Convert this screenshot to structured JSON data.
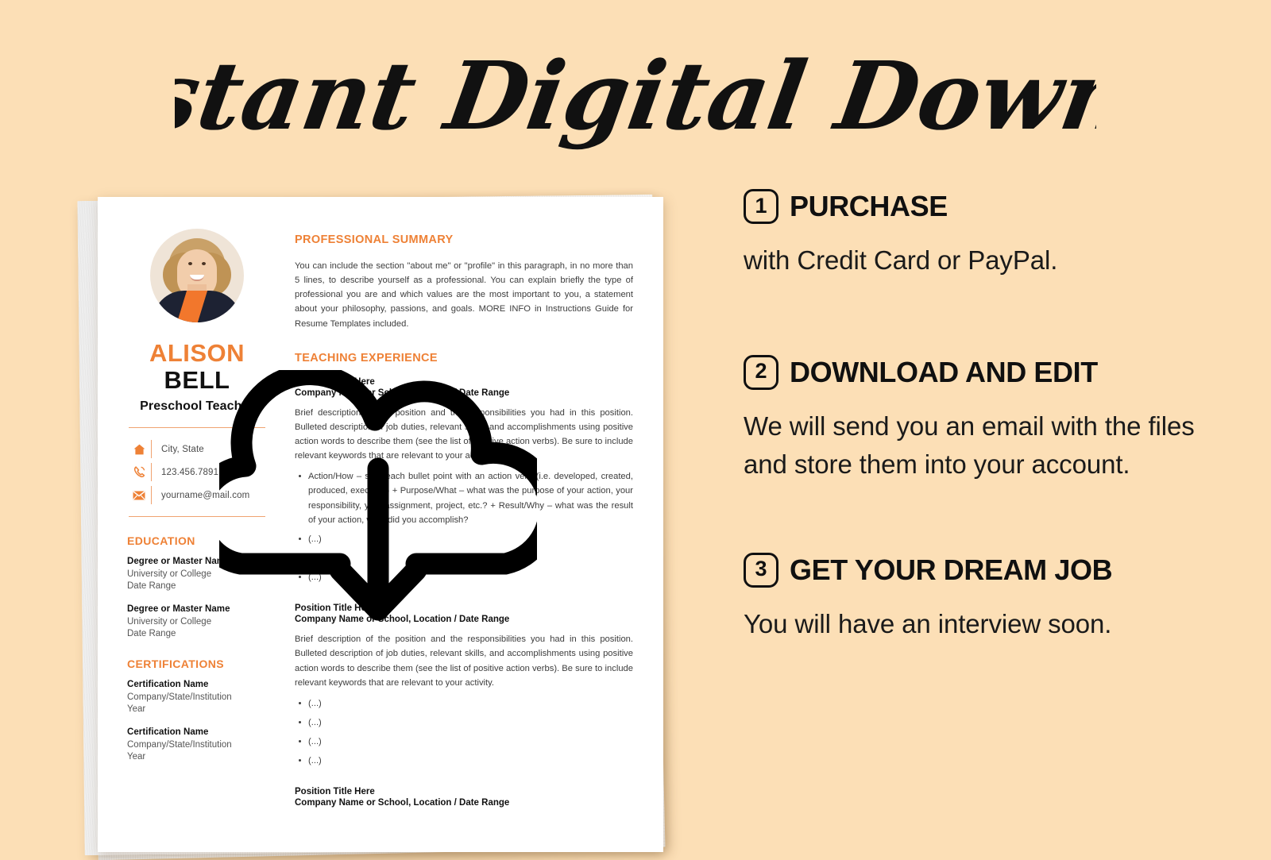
{
  "page": {
    "headline": "Instant Digital Download",
    "background_color": "#fcdfb6",
    "accent_orange": "#ee8136",
    "ink_color": "#101010"
  },
  "overlay_icon": {
    "name": "cloud-download-icon",
    "color": "#000000"
  },
  "resume": {
    "left": {
      "avatar_alt": "Portrait of a smiling blonde woman",
      "first_name": "ALISON",
      "last_name": "BELL",
      "role": "Preschool Teacher",
      "contacts": [
        {
          "icon": "home-icon",
          "text": "City, State"
        },
        {
          "icon": "phone-icon",
          "text": "123.456.7891"
        },
        {
          "icon": "envelope-icon",
          "text": "yourname@mail.com"
        }
      ],
      "education_heading": "EDUCATION",
      "education": [
        {
          "title": "Degree or Master Name",
          "line1": "University or College",
          "line2": "Date Range"
        },
        {
          "title": "Degree or Master Name",
          "line1": "University or College",
          "line2": "Date Range"
        }
      ],
      "certifications_heading": "CERTIFICATIONS",
      "certifications": [
        {
          "title": "Certification Name",
          "line1": "Company/State/Institution",
          "line2": "Year"
        },
        {
          "title": "Certification Name",
          "line1": "Company/State/Institution",
          "line2": "Year"
        }
      ]
    },
    "right": {
      "summary_heading": "PROFESSIONAL SUMMARY",
      "summary_text": "You can include the section \"about me\" or \"profile\" in this paragraph, in no more than 5 lines, to describe yourself as a professional. You can explain briefly the type of professional you are and which values are the most important to you, a statement about your philosophy, passions, and goals. MORE INFO in Instructions Guide for Resume Templates included.",
      "experience_heading": "TEACHING EXPERIENCE",
      "jobs": [
        {
          "title": "Position Title Here",
          "subtitle": "Company Name or School, Location / Date Range",
          "description": "Brief description of the position and the responsibilities you had in this position. Bulleted description of job duties, relevant skills, and accomplishments using positive action words to describe them (see the list of positive action verbs). Be sure to include relevant keywords that are relevant to your activity.",
          "bullets": [
            "Action/How – start each bullet point with an action verb (i.e. developed, created, produced, executed) + Purpose/What – what was the purpose of your action, your responsibility, your assignment, project, etc.? + Result/Why – what was the result of your action, what did you accomplish?",
            "(...)",
            "(...)",
            "(...)"
          ]
        },
        {
          "title": "Position Title Here",
          "subtitle": "Company Name or School, Location / Date Range",
          "description": "Brief description of the position and the responsibilities you had in this position. Bulleted description of job duties, relevant skills, and accomplishments using positive action words to describe them (see the list of positive action verbs). Be sure to include relevant keywords that are relevant to your activity.",
          "bullets": [
            "(...)",
            "(...)",
            "(...)",
            "(...)"
          ]
        },
        {
          "title": "Position Title Here",
          "subtitle": "Company Name or School, Location / Date Range",
          "description": "",
          "bullets": []
        }
      ]
    }
  },
  "steps": [
    {
      "number": "1",
      "title": "PURCHASE",
      "body": "with Credit Card or PayPal."
    },
    {
      "number": "2",
      "title": "DOWNLOAD AND EDIT",
      "body": "We will send you an email with the files and store them into your account."
    },
    {
      "number": "3",
      "title": "GET YOUR DREAM JOB",
      "body": "You will have an interview soon."
    }
  ]
}
